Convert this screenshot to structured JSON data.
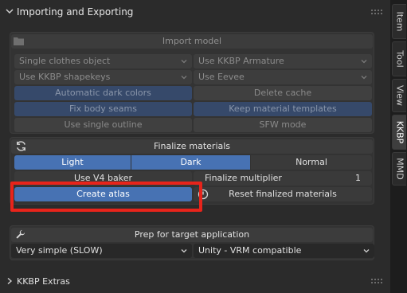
{
  "header": {
    "title": "Importing and Exporting"
  },
  "tabs": [
    {
      "label": "Item",
      "active": false
    },
    {
      "label": "Tool",
      "active": false
    },
    {
      "label": "View",
      "active": false
    },
    {
      "label": "KKBP",
      "active": true
    },
    {
      "label": "MMD",
      "active": false
    }
  ],
  "import": {
    "title": "Import model",
    "clothes_mode": "Single clothes object",
    "armature_mode": "Use KKBP Armature",
    "shapekeys_mode": "Use KKBP shapekeys",
    "renderer": "Use Eevee",
    "auto_dark": "Automatic dark colors",
    "delete_cache": "Delete cache",
    "fix_seams": "Fix body seams",
    "keep_templates": "Keep material templates",
    "single_outline": "Use single outline",
    "sfw_mode": "SFW mode"
  },
  "finalize": {
    "title": "Finalize materials",
    "light": "Light",
    "dark": "Dark",
    "normal": "Normal",
    "v4_baker": "Use V4 baker",
    "multiplier_label": "Finalize multiplier",
    "multiplier_value": "1",
    "create_atlas": "Create atlas",
    "reset": "Reset finalized materials"
  },
  "prep": {
    "title": "Prep for target application",
    "simplify": "Very simple (SLOW)",
    "target": "Unity - VRM compatible"
  },
  "extras": {
    "title": "KKBP Extras"
  },
  "colors": {
    "accent": "#4772b3",
    "highlight": "#e8241b"
  }
}
